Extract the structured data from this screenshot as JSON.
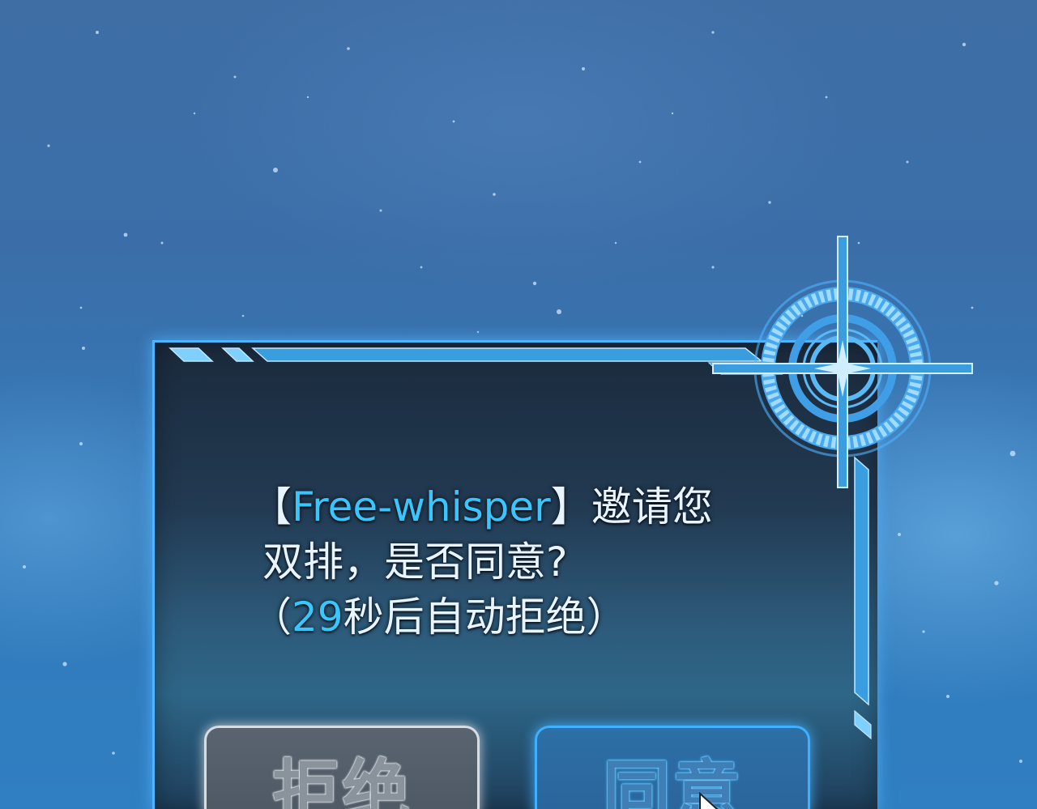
{
  "dialog": {
    "message": {
      "bracket_open": "【",
      "username": "Free-whisper",
      "bracket_close": "】",
      "invite_text": "邀请您",
      "line2": "双排，是否同意?",
      "paren_open": "（",
      "countdown": "29",
      "countdown_suffix": "秒后自动拒绝",
      "paren_close": "）"
    },
    "buttons": {
      "reject_label": "拒绝",
      "accept_label": "同意"
    }
  },
  "colors": {
    "accent": "#39c6ff",
    "border_glow": "#4fb3ff",
    "panel_dark": "#1b2a3c",
    "reject_button": "#5a6470",
    "accept_button": "#2d6fa6"
  },
  "icons": {
    "corner_ornament": "crosshair-reticle-icon",
    "cursor": "mouse-pointer-icon"
  }
}
